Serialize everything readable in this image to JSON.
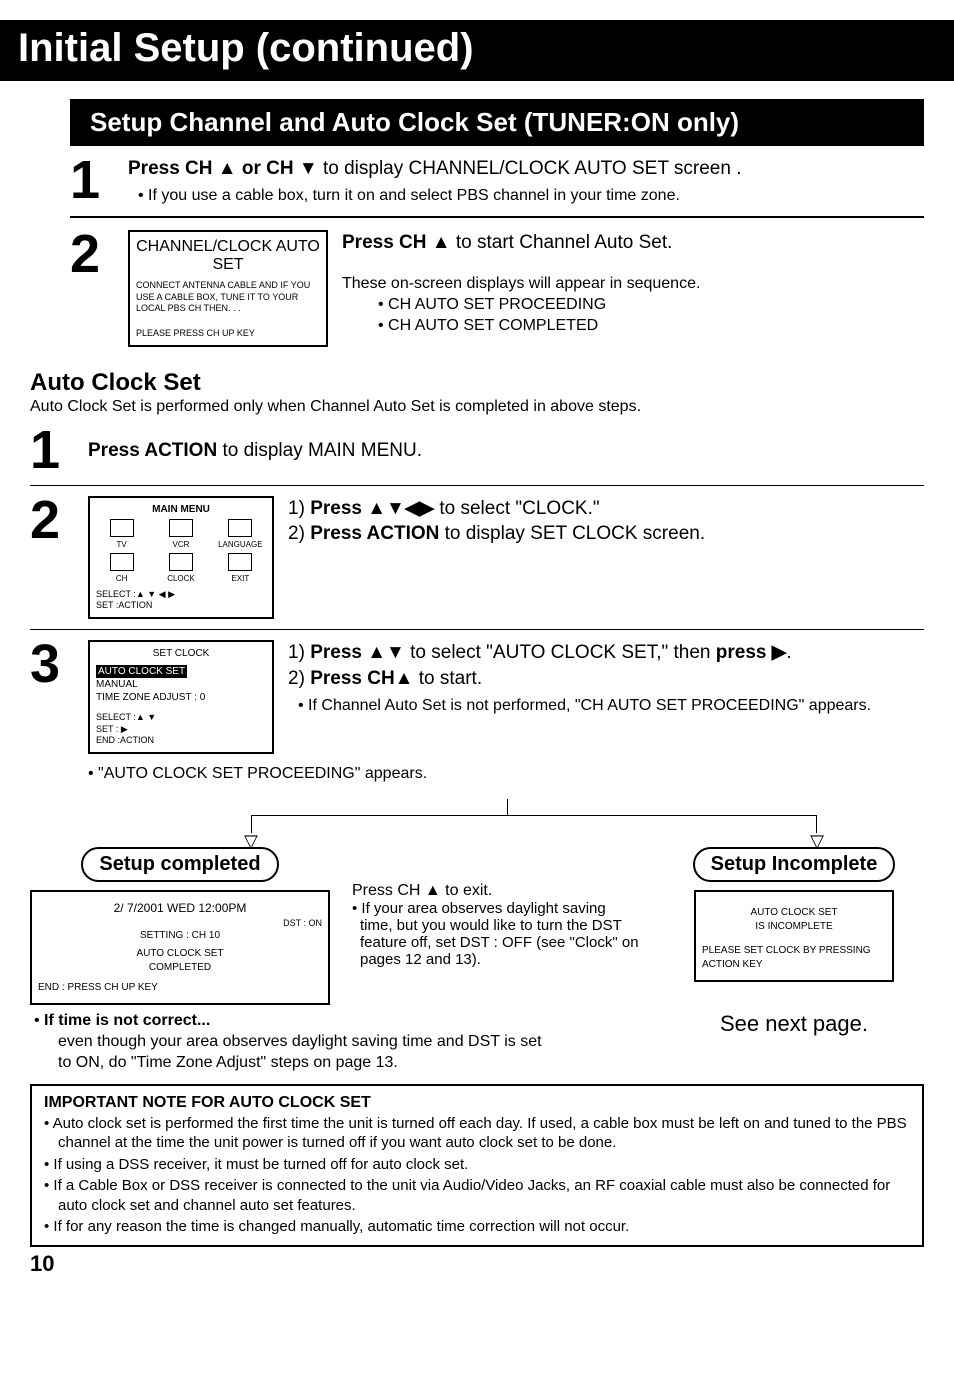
{
  "title": "Initial Setup (continued)",
  "section_bar": "Setup Channel and Auto Clock Set (TUNER:ON only)",
  "step1": {
    "line1_a": "Press CH ",
    "line1_b": " or CH ",
    "line1_c": " to display CHANNEL/CLOCK AUTO SET screen .",
    "bullet": "If you use a cable box, turn it on and select PBS channel in your time zone."
  },
  "step2": {
    "osd_title": "CHANNEL/CLOCK AUTO SET",
    "osd_body": "CONNECT ANTENNA CABLE AND IF YOU USE A CABLE BOX, TUNE IT TO YOUR LOCAL PBS CH     THEN. . .",
    "osd_foot": "PLEASE PRESS CH UP KEY",
    "right_a": "Press CH ",
    "right_b": " to start Channel Auto Set.",
    "seq_intro": "These on-screen displays will appear in sequence.",
    "seq_items": [
      "CH AUTO SET PROCEEDING",
      "CH AUTO SET COMPLETED"
    ]
  },
  "auto_clock": {
    "heading": "Auto Clock Set",
    "intro": "Auto Clock Set is performed only when Channel Auto Set is completed in above steps."
  },
  "ac_step1": "Press ACTION to display MAIN MENU.",
  "ac_step2": {
    "osd_title": "MAIN MENU",
    "menu_items": [
      "TV",
      "VCR",
      "LANGUAGE",
      "CH",
      "CLOCK",
      "EXIT"
    ],
    "osd_foot1": "SELECT :▲ ▼ ◀ ▶",
    "osd_foot2": "SET       :ACTION",
    "line1": "1) Press ▲▼◀▶ to select \"CLOCK.\"",
    "line2": "2) Press ACTION to display SET CLOCK screen."
  },
  "ac_step3": {
    "osd_title": "SET CLOCK",
    "osd_item_hl": "AUTO CLOCK SET",
    "osd_item2": "MANUAL",
    "osd_item3": "TIME ZONE ADJUST  : 0",
    "osd_foot1": "SELECT :▲ ▼",
    "osd_foot2": "SET        : ▶",
    "osd_foot3": "END       :ACTION",
    "line1": "1) Press ▲▼ to select \"AUTO CLOCK SET,\" then press ▶.",
    "line2": "2) Press CH▲ to start.",
    "bullet": "If Channel Auto Set is not performed, \"CH AUTO SET PROCEEDING\" appears.",
    "post_bullet": "\"AUTO CLOCK SET PROCEEDING\" appears."
  },
  "flow": {
    "left_pill": "Setup completed",
    "right_pill": "Setup Incomplete",
    "left_osd": {
      "l1": "2/ 7/2001 WED 12:00PM",
      "l2": "DST : ON",
      "l3": "SETTING  :  CH 10",
      "l4": "AUTO CLOCK SET",
      "l5": "COMPLETED",
      "l6": "END  :  PRESS CH UP KEY"
    },
    "mid": {
      "head": "Press CH ▲ to exit.",
      "bullet": "If your area observes daylight saving time, but you would like to turn the DST feature off, set DST : OFF (see \"Clock\" on pages 12 and 13)."
    },
    "left_note_head": "If time is not correct...",
    "left_note_body": "even though your area observes daylight saving time and DST is set to ON, do \"Time Zone Adjust\" steps on page 13.",
    "right_osd": {
      "l1": "AUTO CLOCK SET",
      "l2": "IS INCOMPLETE",
      "l3": "PLEASE SET CLOCK BY PRESSING ACTION KEY"
    },
    "right_note": "See next page."
  },
  "important": {
    "head": "IMPORTANT NOTE FOR AUTO CLOCK SET",
    "items": [
      "Auto clock set is performed the first time the unit is turned off each day. If used, a cable box must be left on and tuned to the PBS channel at the time the unit power is turned off if you want auto clock set to be done.",
      "If using a DSS receiver, it must be turned off for auto clock set.",
      "If a Cable Box or DSS receiver is connected to the unit via Audio/Video Jacks, an RF coaxial cable must also be connected for auto clock set and channel auto set features.",
      "If for any reason the time is changed manually, automatic time correction will not occur."
    ]
  },
  "page_number": "10"
}
